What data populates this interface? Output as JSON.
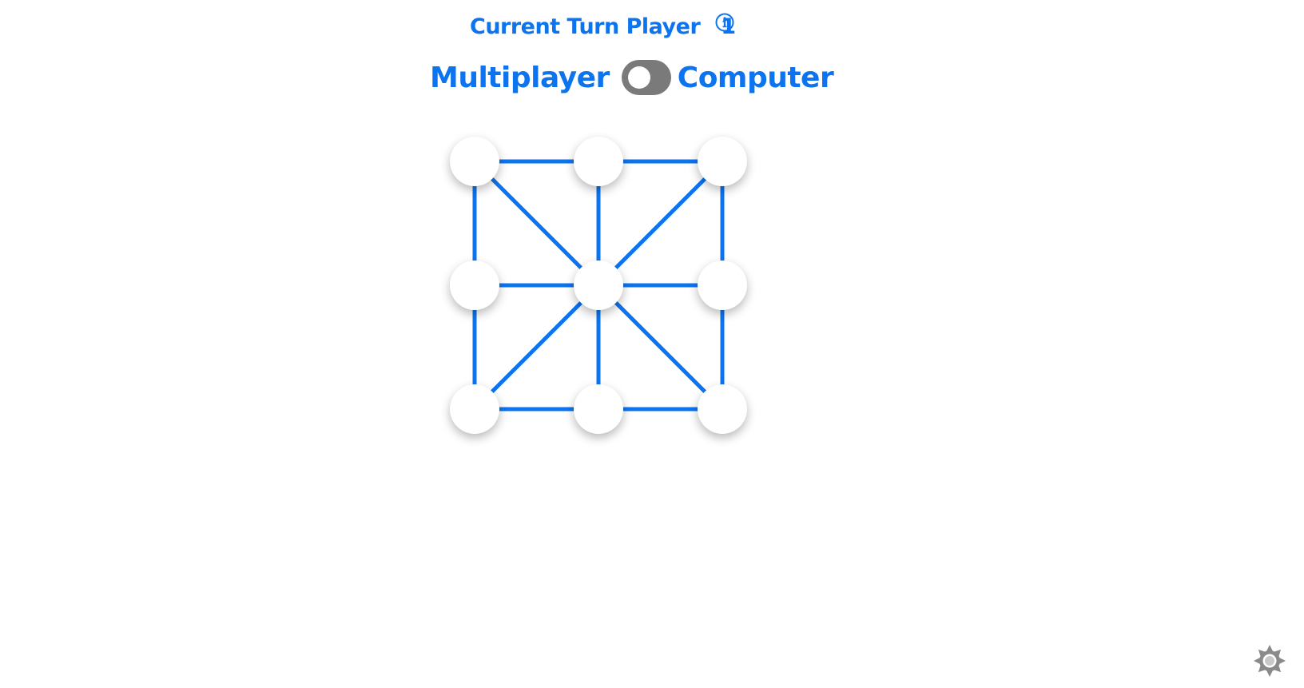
{
  "header": {
    "turn_label": "Current Turn Player",
    "current_player": "1",
    "info_icon": "info-icon"
  },
  "mode": {
    "left_label": "Multiplayer",
    "right_label": "Computer",
    "selected": "Multiplayer"
  },
  "board": {
    "grid": 3,
    "spots": [
      "empty",
      "empty",
      "empty",
      "empty",
      "empty",
      "empty",
      "empty",
      "empty",
      "empty"
    ]
  },
  "colors": {
    "accent": "#0d74f0",
    "toggle_off": "#7a7a7a",
    "gear": "#8a8a8a"
  },
  "settings": {
    "icon": "gear-icon"
  }
}
